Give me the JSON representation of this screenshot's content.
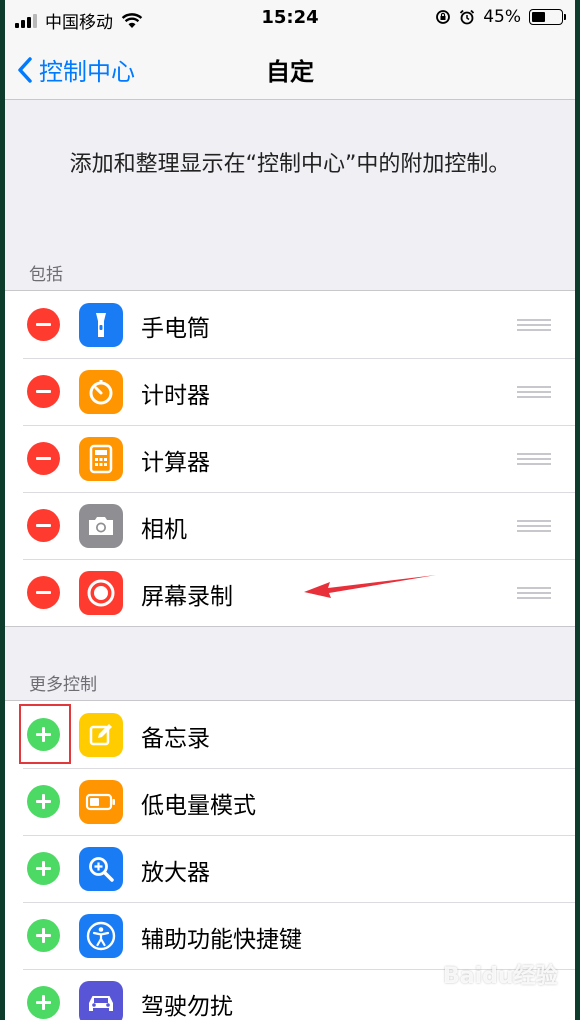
{
  "status_bar": {
    "carrier": "中国移动",
    "time": "15:24",
    "battery": "45%",
    "battery_level": 0.45
  },
  "nav": {
    "back_label": "控制中心",
    "title": "自定"
  },
  "description": "添加和整理显示在“控制中心”中的附加控制。",
  "included": {
    "header": "包括",
    "items": [
      {
        "label": "手电筒",
        "icon": "flashlight-icon",
        "color": "#1a7cf5"
      },
      {
        "label": "计时器",
        "icon": "timer-icon",
        "color": "#ff9500"
      },
      {
        "label": "计算器",
        "icon": "calculator-icon",
        "color": "#ff9500"
      },
      {
        "label": "相机",
        "icon": "camera-icon",
        "color": "#8e8e93"
      },
      {
        "label": "屏幕录制",
        "icon": "screen-record-icon",
        "color": "#ff3b30"
      }
    ]
  },
  "more": {
    "header": "更多控制",
    "items": [
      {
        "label": "备忘录",
        "icon": "notes-icon",
        "color": "#ffcc00"
      },
      {
        "label": "低电量模式",
        "icon": "low-power-icon",
        "color": "#ff9500"
      },
      {
        "label": "放大器",
        "icon": "magnifier-icon",
        "color": "#1a7cf5"
      },
      {
        "label": "辅助功能快捷键",
        "icon": "accessibility-icon",
        "color": "#1a7cf5"
      },
      {
        "label": "驾驶勿扰",
        "icon": "car-icon",
        "color": "#5856d6"
      }
    ]
  },
  "watermark": {
    "text": "Baidu经验",
    "sub": "jingyan.baidu.com"
  }
}
